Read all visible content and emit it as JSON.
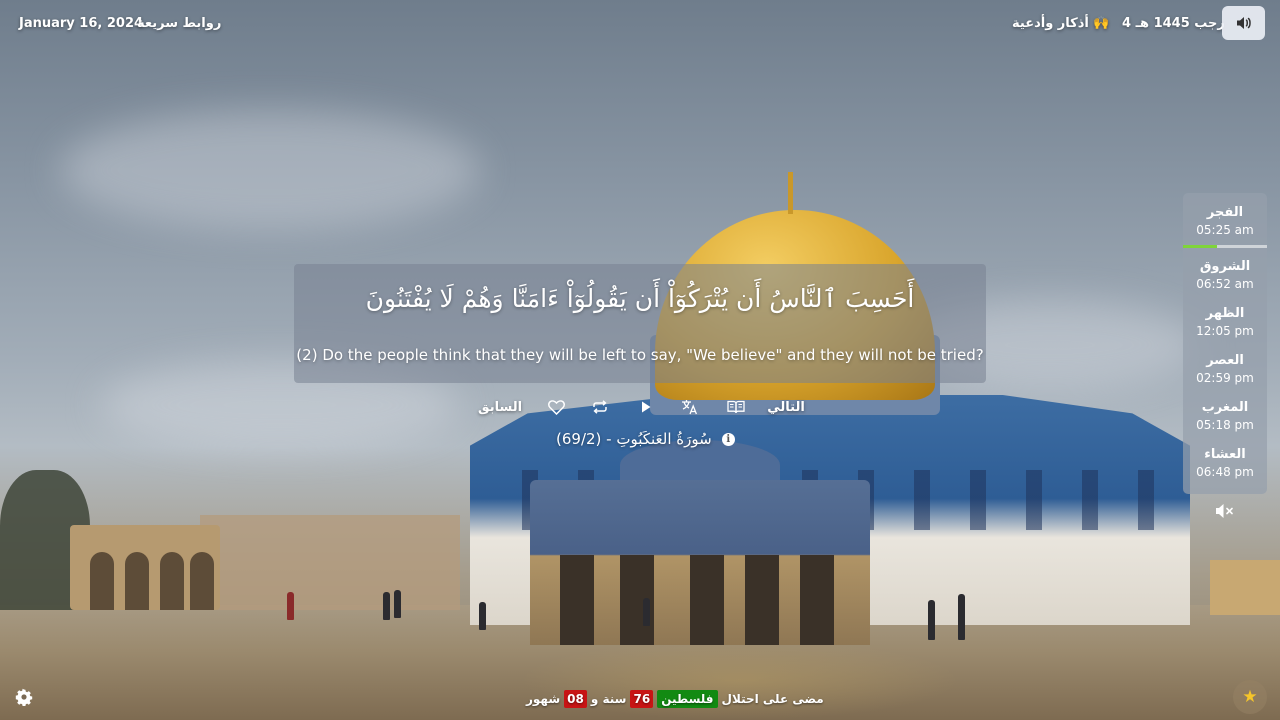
{
  "topbar": {
    "date": "January 16, 2024",
    "quick_links": "روابط سريعة",
    "hijri_date": "4 رجب 1445 هـ",
    "adhkar": "أذكار وأدعية 🙌"
  },
  "verse": {
    "arabic": "أَحَسِبَ ٱلنَّاسُ أَن يُتْرَكُوٓاْ أَن يَقُولُوٓاْ ءَامَنَّا وَهُمْ لَا يُفْتَنُونَ",
    "translation": "(2) Do the people think that they will be left to say, \"We believe\" and they will not be tried?",
    "surah_ref": "سُورَةُ العَنكَبُوتِ - (69/2)"
  },
  "controls": {
    "next_label": "التالي",
    "prev_label": "السابق",
    "icons": [
      "book-icon",
      "translate-icon",
      "play-icon",
      "repeat-icon",
      "heart-icon"
    ]
  },
  "prayers": [
    {
      "name": "الفجر",
      "time": "05:25 am"
    },
    {
      "name": "الشروق",
      "time": "06:52 am"
    },
    {
      "name": "الظهر",
      "time": "12:05 pm"
    },
    {
      "name": "العصر",
      "time": "02:59 pm"
    },
    {
      "name": "المغرب",
      "time": "05:18 pm"
    },
    {
      "name": "العشاء",
      "time": "06:48 pm"
    }
  ],
  "prayer_progress_fraction": 0.4,
  "occupation_counter": {
    "prefix": "مضى على احتلال",
    "country": "فلسطين",
    "years": "76",
    "years_word": "سنة و",
    "months": "08",
    "months_word": "شهور"
  },
  "colors": {
    "accent_green": "#128a12",
    "accent_red": "#c81414",
    "progress_green": "#7fd43a",
    "dome_gold": "#d9a52c"
  }
}
